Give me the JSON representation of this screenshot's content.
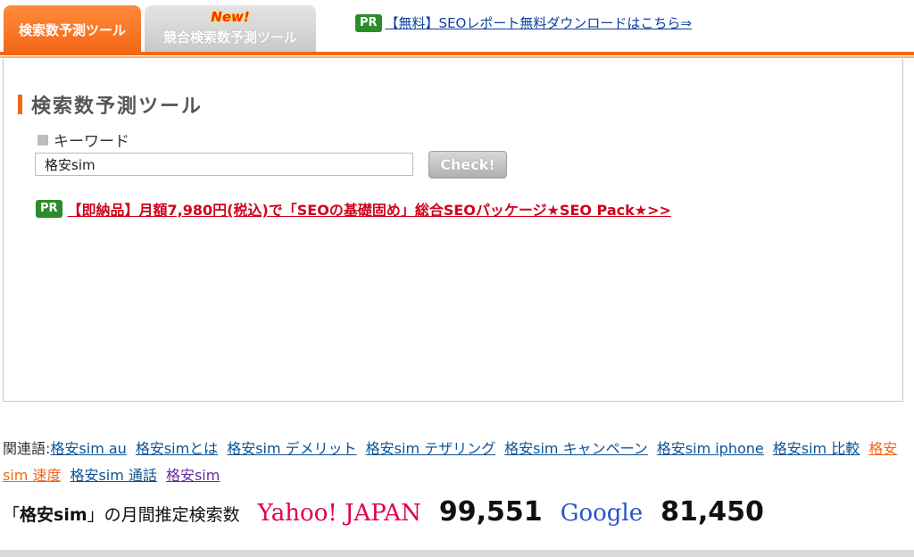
{
  "tabs": {
    "active_label": "検索数予測ツール",
    "inactive_new": "New!",
    "inactive_label": "競合検索数予測ツール"
  },
  "top_ad": {
    "badge": "PR",
    "link": "【無料】SEOレポート無料ダウンロードはこちら⇒"
  },
  "panel": {
    "title": "検索数予測ツール",
    "keyword_label": "キーワード",
    "keyword_value": "格安sim",
    "check_label": "Check!"
  },
  "mid_ad": {
    "badge": "PR",
    "link": "【即納品】月額7,980円(税込)で「SEOの基礎固め」総合SEOパッケージ★SEO Pack★>>"
  },
  "related": {
    "label": "関連語:",
    "items": [
      "格安sim au",
      "格安simとは",
      "格安sim デメリット",
      "格安sim テザリング",
      "格安sim キャンペーン",
      "格安sim iphone",
      "格安sim 比較",
      "格安sim 速度",
      "格安sim 通話",
      "格安sim"
    ]
  },
  "counts": {
    "query_open": "「",
    "query_keyword": "格安sim",
    "query_close": "」の月間推定検索数",
    "yahoo_label": "Yahoo! JAPAN",
    "yahoo_value": "99,551",
    "google_label": "Google",
    "google_value": "81,450"
  },
  "colors": {
    "accent": "#f26717",
    "pr_green": "#2a8c2a",
    "link_blue": "#0b5394",
    "ad_red": "#d0021b"
  }
}
